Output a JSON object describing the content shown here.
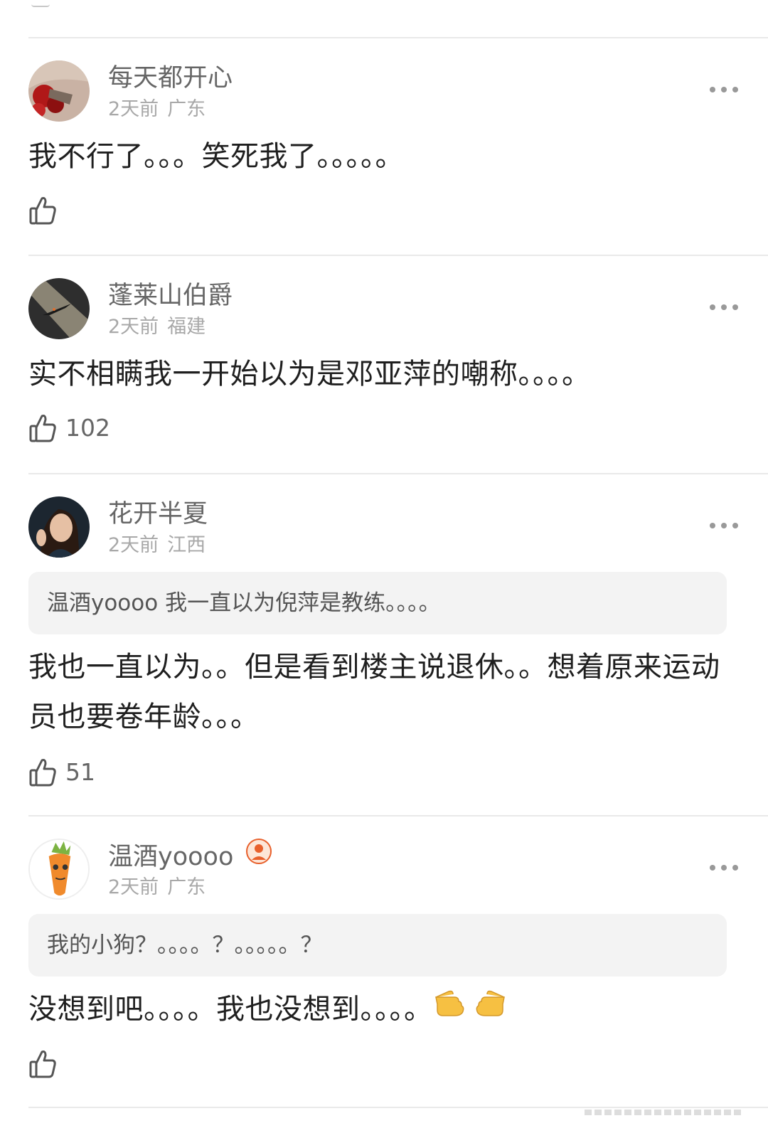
{
  "comments": [
    {
      "username": "每天都开心",
      "time": "2天前",
      "location": "广东",
      "text": "我不行了。。。笑死我了。。。。。",
      "likes": ""
    },
    {
      "username": "蓬莱山伯爵",
      "time": "2天前",
      "location": "福建",
      "text": "实不相瞒我一开始以为是邓亚萍的嘲称。。。。",
      "likes": "102"
    },
    {
      "username": "花开半夏",
      "time": "2天前",
      "location": "江西",
      "quote": "温酒yoooo 我一直以为倪萍是教练。。。。",
      "text": "我也一直以为。。但是看到楼主说退休。。想着原来运动员也要卷年龄。。。",
      "likes": "51"
    },
    {
      "username": "温酒yoooo",
      "time": "2天前",
      "location": "广东",
      "quote": "我的小狗？。。。。？。。。。。？",
      "text": "没想到吧。。。。我也没想到。。。。",
      "likes": ""
    }
  ],
  "icons": {
    "more": "more-horizontal-icon",
    "like": "thumbs-up-icon",
    "badge": "fan-badge-icon",
    "emoji": "pointing-hands-emoji"
  },
  "colors": {
    "username": "#666666",
    "meta": "#a8a8a8",
    "text": "#1f1f1f",
    "quote_bg": "#f3f3f3",
    "divider": "#e9e9e9"
  }
}
